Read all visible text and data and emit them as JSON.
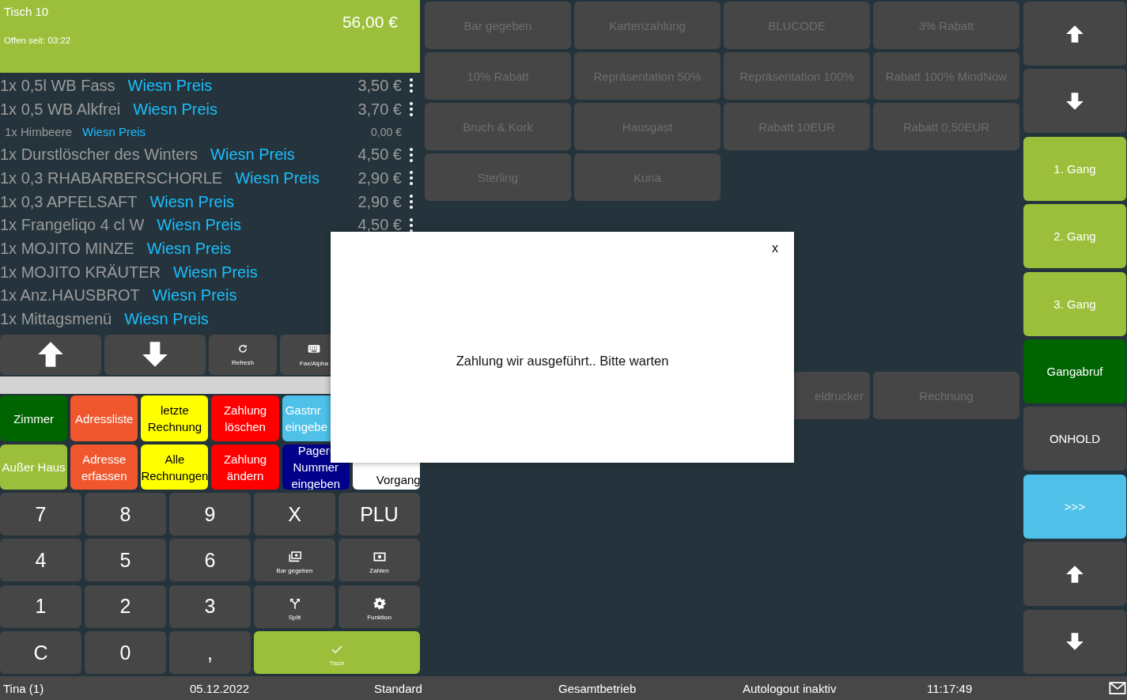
{
  "order": {
    "table": "Tisch 10",
    "total": "56,00 €",
    "open_since": "Offen seit: 03:22",
    "items": [
      {
        "kind": "item",
        "name": "1x 0,5l WB Fass",
        "tag": "Wiesn Preis",
        "price": "3,50 €",
        "menu": true
      },
      {
        "kind": "item",
        "name": "1x 0,5 WB Alkfrei",
        "tag": "Wiesn Preis",
        "price": "3,70 €",
        "menu": true
      },
      {
        "kind": "sub",
        "name": "1x Himbeere",
        "tag": "Wiesn Preis",
        "price": "0,00 €",
        "menu": false
      },
      {
        "kind": "item",
        "name": "1x Durstlöscher des Winters",
        "tag": "Wiesn Preis",
        "price": "4,50 €",
        "menu": true
      },
      {
        "kind": "item",
        "name": "1x 0,3 RHABARBERSCHORLE",
        "tag": "Wiesn Preis",
        "price": "2,90 €",
        "menu": true
      },
      {
        "kind": "item",
        "name": "1x 0,3 APFELSAFT",
        "tag": "Wiesn Preis",
        "price": "2,90 €",
        "menu": true
      },
      {
        "kind": "item",
        "name": "1x Frangeliqo 4 cl W",
        "tag": "Wiesn Preis",
        "price": "4,50 €",
        "menu": true
      },
      {
        "kind": "item",
        "name": "1x MOJITO MINZE",
        "tag": "Wiesn Preis"
      },
      {
        "kind": "item",
        "name": "1x MOJITO KRÄUTER",
        "tag": "Wiesn Preis"
      },
      {
        "kind": "item",
        "name": "1x Anz.HAUSBROT",
        "tag": "Wiesn Preis"
      },
      {
        "kind": "item",
        "name": "1x Mittagsmenü",
        "tag": "Wiesn Preis"
      }
    ]
  },
  "toolbar": [
    {
      "kind": "scroll_up"
    },
    {
      "kind": "scroll_down"
    },
    {
      "kind": "refresh",
      "label": "Refresh"
    },
    {
      "kind": "fax_alpha",
      "label": "Fax/Alpha"
    }
  ],
  "functions": [
    {
      "label": "Zimmer",
      "color": "#006400"
    },
    {
      "label": "Adressliste",
      "color": "#f0572e"
    },
    {
      "label": "letzte Rechnung",
      "color": "#ffff00"
    },
    {
      "label": "Zahlung löschen",
      "color": "#ff0000"
    },
    {
      "label": "Gastnr eingebe",
      "color": "#4fc1e9",
      "covered": true
    },
    {
      "label": "Außer Haus",
      "color": "#9bbf3a"
    },
    {
      "label": "Adresse erfassen",
      "color": "#f0572e"
    },
    {
      "label": "Alle Rechnungen",
      "color": "#ffff00"
    },
    {
      "label": "Zahlung ändern",
      "color": "#ff0000"
    },
    {
      "label": "Pager-Nummer eingeben",
      "color": "#00008b"
    },
    {
      "label": "Vorgang",
      "color": "#ffffff",
      "covered": true
    }
  ],
  "keypad": [
    {
      "kind": "digit",
      "label": "7"
    },
    {
      "kind": "digit",
      "label": "8"
    },
    {
      "kind": "digit",
      "label": "9"
    },
    {
      "kind": "digit",
      "label": "X"
    },
    {
      "kind": "digit",
      "label": "PLU"
    },
    {
      "kind": "digit",
      "label": "4"
    },
    {
      "kind": "digit",
      "label": "5"
    },
    {
      "kind": "digit",
      "label": "6"
    },
    {
      "kind": "cash_given",
      "label": "Bar gegeben"
    },
    {
      "kind": "pay",
      "label": "Zahlen"
    },
    {
      "kind": "digit",
      "label": "1"
    },
    {
      "kind": "digit",
      "label": "2"
    },
    {
      "kind": "digit",
      "label": "3"
    },
    {
      "kind": "split",
      "label": "Split"
    },
    {
      "kind": "function",
      "label": "Funktion"
    },
    {
      "kind": "digit",
      "label": "C"
    },
    {
      "kind": "digit",
      "label": "0"
    },
    {
      "kind": "digit",
      "label": ","
    },
    {
      "kind": "table",
      "label": "Tisch"
    }
  ],
  "payment_options": [
    "Bar gegeben",
    "Kartenzahlung",
    "BLUCODE",
    "3% Rabatt",
    "10% Rabatt",
    "Repräsentation 50%",
    "Repräsentation 100%",
    "Rabatt 100% MindNow",
    "Bruch & Kork",
    "Hausgast",
    "Rabatt 10EUR",
    "Rabatt 0,50EUR",
    "Sterling",
    "Kuna"
  ],
  "print_options": [
    "eldrucker",
    "Rechnung"
  ],
  "side": [
    {
      "kind": "scroll_up",
      "color": "#464646"
    },
    {
      "kind": "scroll_down",
      "color": "#464646"
    },
    {
      "kind": "label",
      "label": "1. Gang",
      "color": "#9bbf3a"
    },
    {
      "kind": "label",
      "label": "2. Gang",
      "color": "#9bbf3a"
    },
    {
      "kind": "label",
      "label": "3. Gang",
      "color": "#9bbf3a"
    },
    {
      "kind": "label",
      "label": "Gangabruf",
      "color": "#006400"
    },
    {
      "kind": "label",
      "label": "ONHOLD",
      "color": "#464646"
    },
    {
      "kind": "label",
      "label": ">>>",
      "color": "#4fc1e9"
    },
    {
      "kind": "scroll_up",
      "color": "#464646"
    },
    {
      "kind": "scroll_down",
      "color": "#464646"
    }
  ],
  "status_bar": {
    "user": "Tina (1)",
    "date": "05.12.2022",
    "mode": "Standard",
    "area": "Gesamtbetrieb",
    "autologout": "Autologout inaktiv",
    "time": "11:17:49"
  },
  "dialog": {
    "close": "x",
    "message": "Zahlung wir ausgeführt.. Bitte warten"
  }
}
